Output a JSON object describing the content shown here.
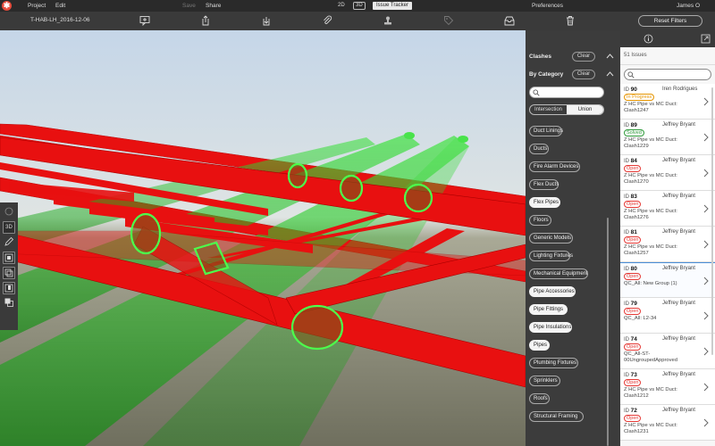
{
  "menubar": {
    "logo_glyph": "✱",
    "items": [
      "Project",
      "Edit",
      "Save",
      "Share"
    ],
    "view_2d": "2D",
    "view_3d": "3D",
    "issue_tracker": "Issue Tracker",
    "preferences": "Preferences",
    "user": "James O"
  },
  "toolbar": {
    "doc_title": "T-HAB-LH_2016-12-06",
    "icons": [
      "add-comment-icon",
      "upload-icon",
      "download-icon",
      "attach-icon",
      "stamp-icon",
      "tag-icon",
      "inbox-icon",
      "trash-icon"
    ],
    "reset_filters": "Reset Filters"
  },
  "left_tools": {
    "btn_3d": "3D"
  },
  "filter_panel": {
    "clashes_title": "Clashes",
    "clashes_clear": "Clear",
    "category_title": "By Category",
    "category_clear": "Clear",
    "seg_intersection": "Intersection",
    "seg_union": "Union",
    "categories": [
      {
        "label": "Duct Linings",
        "selected": false
      },
      {
        "label": "Ducts",
        "selected": false
      },
      {
        "label": "Fire Alarm Devices",
        "selected": false
      },
      {
        "label": "Flex Ducts",
        "selected": false
      },
      {
        "label": "Flex Pipes",
        "selected": true
      },
      {
        "label": "Floors",
        "selected": false
      },
      {
        "label": "Generic Models",
        "selected": false
      },
      {
        "label": "Lighting Fixtures",
        "selected": false
      },
      {
        "label": "Mechanical Equipment",
        "selected": false
      },
      {
        "label": "Pipe Accessories",
        "selected": true
      },
      {
        "label": "Pipe Fittings",
        "selected": true
      },
      {
        "label": "Pipe Insulations",
        "selected": true
      },
      {
        "label": "Pipes",
        "selected": true
      },
      {
        "label": "Plumbing Fixtures",
        "selected": false
      },
      {
        "label": "Sprinklers",
        "selected": false
      },
      {
        "label": "Roofs",
        "selected": false
      },
      {
        "label": "Structural Framing",
        "selected": false
      }
    ]
  },
  "issues_panel": {
    "count": "51 Issues",
    "issues": [
      {
        "id_label": "ID",
        "id": "90",
        "assignee": "Iren Rodrigues",
        "status": "In Progress",
        "status_class": "st-inprogress",
        "desc1": "Z HC Pipe vs MC Duct:",
        "desc2": "Clash1247",
        "selected": false
      },
      {
        "id_label": "ID",
        "id": "89",
        "assignee": "Jeffrey Bryant",
        "status": "Solved",
        "status_class": "st-solved",
        "desc1": "Z HC Pipe vs MC Duct:",
        "desc2": "Clash1229",
        "selected": false
      },
      {
        "id_label": "ID",
        "id": "84",
        "assignee": "Jeffrey Bryant",
        "status": "Open",
        "status_class": "st-open",
        "desc1": "Z HC Pipe vs MC Duct:",
        "desc2": "Clash1270",
        "selected": false
      },
      {
        "id_label": "ID",
        "id": "83",
        "assignee": "Jeffrey Bryant",
        "status": "Open",
        "status_class": "st-open",
        "desc1": "Z HC Pipe vs MC Duct:",
        "desc2": "Clash1276",
        "selected": false
      },
      {
        "id_label": "ID",
        "id": "81",
        "assignee": "Jeffrey Bryant",
        "status": "Open",
        "status_class": "st-open",
        "desc1": "Z HC Pipe vs MC Duct:",
        "desc2": "Clash1257",
        "selected": false
      },
      {
        "id_label": "ID",
        "id": "80",
        "assignee": "Jeffrey Bryant",
        "status": "Open",
        "status_class": "st-open",
        "desc1": "QC_All: New Group (1)",
        "desc2": "",
        "selected": true
      },
      {
        "id_label": "ID",
        "id": "79",
        "assignee": "Jeffrey Bryant",
        "status": "Open",
        "status_class": "st-open",
        "desc1": "QC_All: L2-34",
        "desc2": "",
        "selected": false
      },
      {
        "id_label": "ID",
        "id": "74",
        "assignee": "Jeffrey Bryant",
        "status": "Open",
        "status_class": "st-open",
        "desc1": "QC_All-ST-",
        "desc2": "00UngroupedApproved",
        "selected": false
      },
      {
        "id_label": "ID",
        "id": "73",
        "assignee": "Jeffrey Bryant",
        "status": "Open",
        "status_class": "st-open",
        "desc1": "Z HC Pipe vs MC Duct:",
        "desc2": "Clash1212",
        "selected": false
      },
      {
        "id_label": "ID",
        "id": "72",
        "assignee": "Jeffrey Bryant",
        "status": "Open",
        "status_class": "st-open",
        "desc1": "Z HC Pipe vs MC Duct:",
        "desc2": "Clash1231",
        "selected": false
      }
    ]
  },
  "colors": {
    "beam_red": "#e81010",
    "pipe_green": "#22c322",
    "clash_edge": "#4cff4c",
    "sky_top": "#c9d8e8",
    "ground": "#7e7e6a",
    "status_open": "#e53935",
    "status_progress": "#e69500",
    "status_solved": "#2e9a3a",
    "accent_blue": "#4a8fd8"
  }
}
